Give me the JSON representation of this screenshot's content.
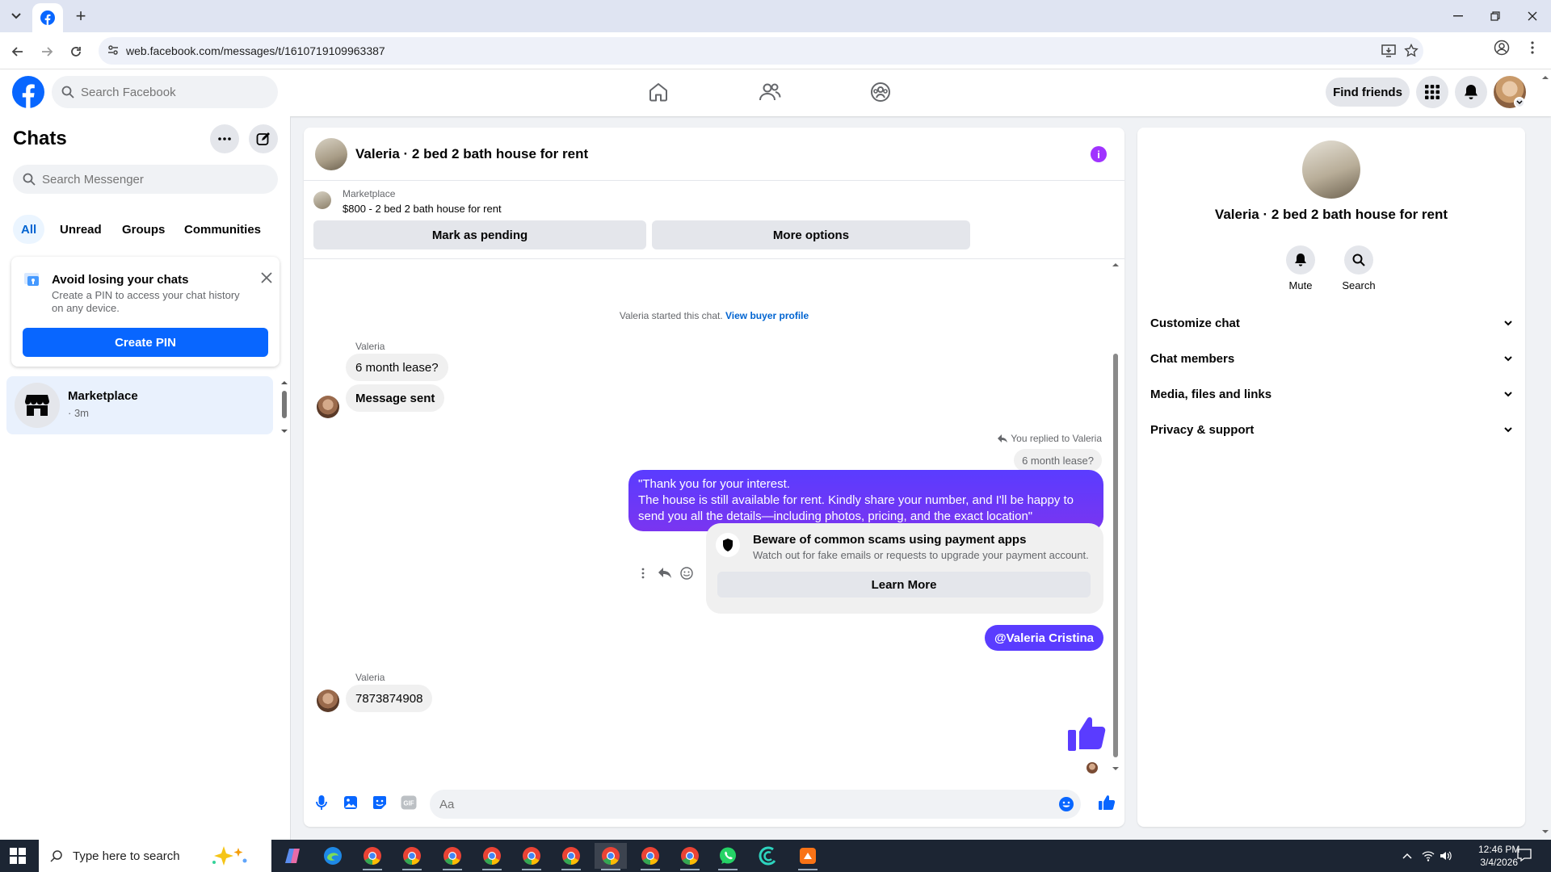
{
  "browser": {
    "url": "web.facebook.com/messages/t/1610719109963387"
  },
  "header": {
    "search_placeholder": "Search Facebook",
    "find_friends": "Find friends"
  },
  "left": {
    "title": "Chats",
    "search_placeholder": "Search Messenger",
    "tabs": [
      "All",
      "Unread",
      "Groups",
      "Communities"
    ],
    "pin_card": {
      "title": "Avoid losing your chats",
      "description": "Create a PIN to access your chat history on any device.",
      "button": "Create PIN"
    },
    "chat_items": [
      {
        "name": "Marketplace",
        "meta": "· 3m"
      }
    ]
  },
  "chat": {
    "title": "Valeria · 2 bed 2 bath house for rent",
    "marketplace_label": "Marketplace",
    "listing": "$800 - 2 bed 2 bath house for rent",
    "mark_pending": "Mark as pending",
    "more_options": "More options",
    "system_text": "Valeria started this chat.",
    "system_link": "View buyer profile",
    "messages_in_1": {
      "sender": "Valeria",
      "bubbles": [
        "6 month lease?",
        "Message sent"
      ]
    },
    "replied_label": "You replied to Valeria",
    "quoted": "6 month lease?",
    "outgoing_lines": [
      "\"Thank you for your interest.",
      "The house is still available for rent. Kindly share your number, and I'll be happy to",
      "send you all the details—including photos, pricing, and the exact location\""
    ],
    "scam": {
      "title": "Beware of common scams using payment apps",
      "desc": "Watch out for fake emails or requests to upgrade your payment account.",
      "button": "Learn More"
    },
    "mention": "@Valeria Cristina",
    "messages_in_2": {
      "sender": "Valeria",
      "bubble": "7873874908"
    },
    "composer_placeholder": "Aa"
  },
  "right": {
    "title": "Valeria · 2 bed 2 bath house for rent",
    "actions": [
      "Mute",
      "Search"
    ],
    "sections": [
      "Customize chat",
      "Chat members",
      "Media, files and links",
      "Privacy & support"
    ]
  },
  "taskbar": {
    "search_placeholder": "Type here to search",
    "time": "12:46 PM",
    "date": "3/4/2026"
  },
  "colors": {
    "fb_blue": "#0866ff",
    "outgoing": "#5a3cff",
    "info": "#a033ff"
  }
}
